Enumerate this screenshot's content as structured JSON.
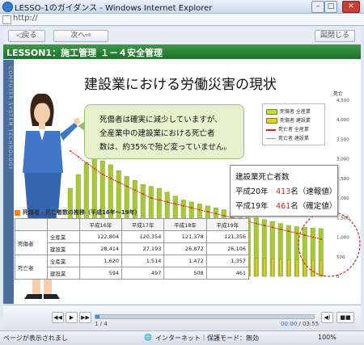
{
  "window": {
    "title": "LESSO-1のガイダンス - Windows Internet Explorer"
  },
  "address": {
    "url": "http://"
  },
  "nav": {
    "back": "◁戻る",
    "next": "次へ⇨",
    "close": "図閉じる"
  },
  "lesson": {
    "label": "LESSON1：施工管理",
    "section": "１－４安全管理"
  },
  "side_text": "COMPUTER SYSTEM TECHNOLOGY",
  "headline": "建設業における労働災害の現状",
  "bubble": {
    "line1": "死傷者は確実に減少していますが、",
    "line2": "全産業中の建設業における死亡者",
    "line3": "数は、約35%で殆ど変っていません。"
  },
  "legend": {
    "items": [
      {
        "label": "死傷者 全産業",
        "color": "#c7d93a"
      },
      {
        "label": "死傷者 建設業",
        "color": "#d9ce35"
      },
      {
        "label": "死亡者 全産業",
        "color": "#e0201a"
      },
      {
        "label": "死亡者 建設業",
        "color": "#f07e3a"
      }
    ]
  },
  "deaths_box": {
    "title": "建設業死亡者数",
    "line1_prefix": "平成20年",
    "line1_value": "413",
    "line1_suffix": "名（速報値）",
    "line2_prefix": "平成19年",
    "line2_value": "461",
    "line2_suffix": "名（確定値）"
  },
  "table": {
    "title": "死傷者・死亡者数の推移（平成16年～19年）",
    "headers": [
      "",
      "",
      "平成16年",
      "平成17年",
      "平成18年",
      "平成19年"
    ],
    "rows": [
      {
        "group": "死傷者",
        "sector": "全産業",
        "values": [
          "122,804",
          "120,354",
          "121,378",
          "121,356"
        ]
      },
      {
        "group": "",
        "sector": "建設業",
        "values": [
          "28,414",
          "27,193",
          "26,872",
          "26,106"
        ]
      },
      {
        "group": "死亡者",
        "sector": "全産業",
        "values": [
          "1,620",
          "1,514",
          "1,472",
          "1,357"
        ]
      },
      {
        "group": "",
        "sector": "建設業",
        "values": [
          "594",
          "497",
          "508",
          "461"
        ]
      }
    ]
  },
  "chart_data": {
    "type": "bar",
    "title": "",
    "ylabel": "死亡",
    "y_ticks": [
      "4,500",
      "4,000",
      "3,500",
      "3,000",
      "2,500",
      "2,000",
      "1,500",
      "1,000",
      "500",
      "0"
    ],
    "ylim": [
      0,
      4500
    ],
    "series": [
      {
        "name": "死傷者 全産業",
        "values": [
          2250,
          2600,
          2900,
          3000,
          2950,
          2850,
          2700,
          2550,
          2450,
          2350,
          2300,
          2250,
          2150,
          2050,
          1950,
          1900,
          1850,
          1800,
          1750,
          1700,
          1650,
          1600,
          1550,
          1500,
          1450,
          1400,
          1350,
          1300,
          1270,
          1250,
          1230,
          1220
        ]
      },
      {
        "name": "死傷者 建設業",
        "values": [
          900,
          1000,
          1100,
          1150,
          1100,
          1050,
          1000,
          950,
          900,
          860,
          820,
          780,
          740,
          700,
          670,
          640,
          610,
          580,
          560,
          540,
          520,
          500,
          480,
          470,
          460,
          450,
          440,
          430,
          420,
          415,
          410,
          405
        ]
      },
      {
        "name": "死亡者 全産業",
        "values": [
          3200,
          3050,
          2900,
          2750,
          2600,
          2500,
          2400,
          2300,
          2200,
          2100,
          2000,
          1950,
          1900,
          1850,
          1800,
          1750,
          1700,
          1650,
          1600,
          1550,
          1500,
          1450,
          1400,
          1350,
          1300,
          1250,
          1200,
          1150,
          1100,
          1050,
          1000,
          950
        ]
      }
    ]
  },
  "player": {
    "page": "1 / 4",
    "current": "00:00",
    "total": "/ 03:55",
    "progress": 0.02
  },
  "status": {
    "left": "ページが表示されまし",
    "zone": "インターネット｜保護モード：無効",
    "zoom": "100%"
  }
}
